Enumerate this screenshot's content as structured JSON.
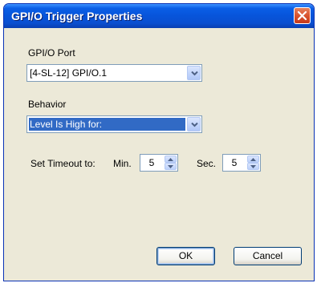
{
  "window": {
    "title": "GPI/O Trigger Properties"
  },
  "gpio_port": {
    "label": "GPI/O Port",
    "selected": "[4-SL-12] GPI/O.1"
  },
  "behavior": {
    "label": "Behavior",
    "selected": "Level Is High for:"
  },
  "timeout": {
    "label": "Set Timeout to:",
    "min_label": "Min.",
    "min_value": "5",
    "sec_label": "Sec.",
    "sec_value": "5"
  },
  "buttons": {
    "ok": "OK",
    "cancel": "Cancel"
  },
  "icons": {
    "close": "close-icon",
    "dropdown": "chevron-down-icon",
    "spin_up": "arrow-up-icon",
    "spin_down": "arrow-down-icon"
  }
}
